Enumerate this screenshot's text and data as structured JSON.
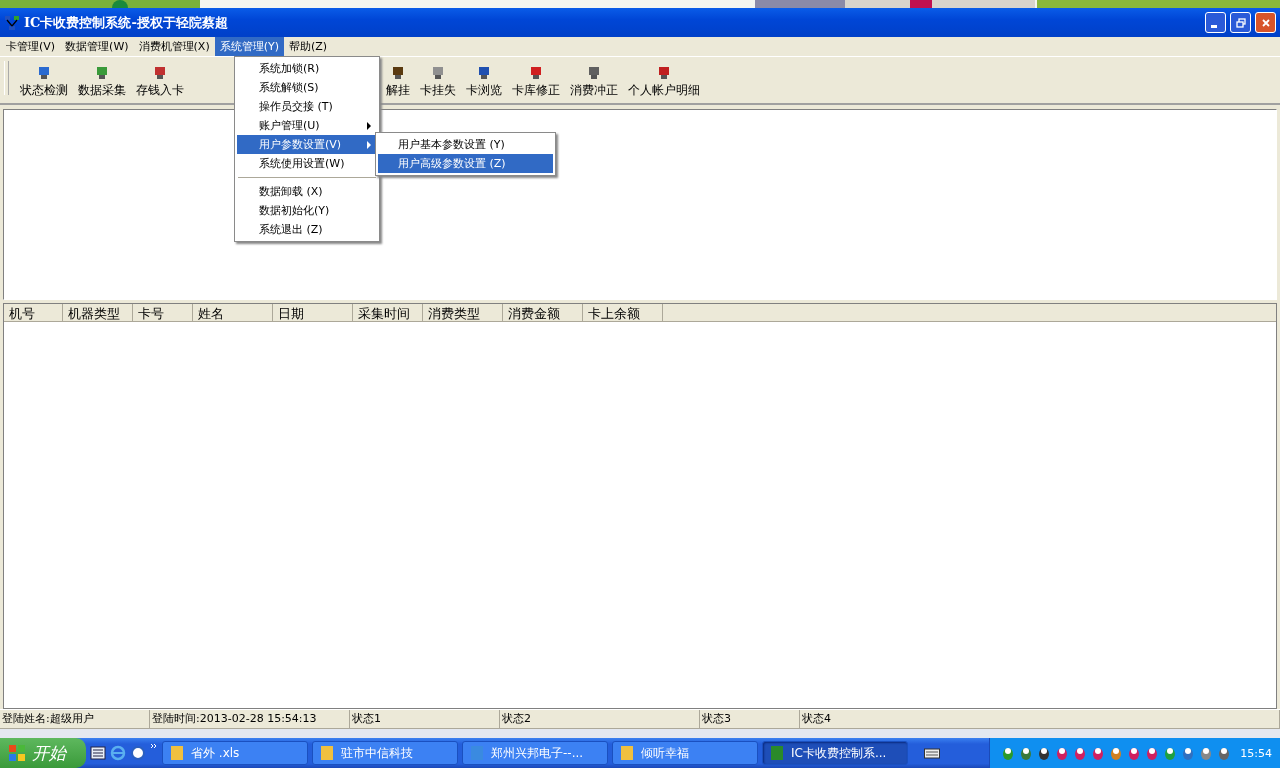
{
  "window": {
    "title": "IC卡收费控制系统-授权于轻院蔡超"
  },
  "menu": [
    {
      "label": "卡管理(V)",
      "selected": false
    },
    {
      "label": "数据管理(W)",
      "selected": false
    },
    {
      "label": "消费机管理(X)",
      "selected": false
    },
    {
      "label": "系统管理(Y)",
      "selected": true
    },
    {
      "label": "帮助(Z)",
      "selected": false
    }
  ],
  "dropdown": [
    {
      "kind": "item",
      "label": "系统加锁(R)",
      "selected": false
    },
    {
      "kind": "item",
      "label": "系统解锁(S)",
      "selected": false
    },
    {
      "kind": "item",
      "label": "操作员交接  (T)",
      "selected": false
    },
    {
      "kind": "submenu",
      "label": "账户管理(U)",
      "selected": false
    },
    {
      "kind": "submenu",
      "label": "用户参数设置(V)",
      "selected": true
    },
    {
      "kind": "item",
      "label": "系统使用设置(W)",
      "selected": false
    },
    {
      "kind": "separator"
    },
    {
      "kind": "item",
      "label": "数据卸载  (X)",
      "selected": false
    },
    {
      "kind": "item",
      "label": "数据初始化(Y)",
      "selected": false
    },
    {
      "kind": "item",
      "label": "系统退出  (Z)",
      "selected": false
    }
  ],
  "submenu": [
    {
      "label": "用户基本参数设置  (Y)",
      "selected": false
    },
    {
      "label": "用户高级参数设置  (Z)",
      "selected": true
    }
  ],
  "toolbar": [
    "状态检测",
    "数据采集",
    "存钱入卡",
    "解挂",
    "卡挂失",
    "卡浏览",
    "卡库修正",
    "消费冲正",
    "个人帐户明细"
  ],
  "table": {
    "columns": [
      "机号",
      "机器类型",
      "卡号",
      "姓名",
      "日期",
      "采集时间",
      "消费类型",
      "消费金额",
      "卡上余额"
    ]
  },
  "status_bar": [
    "登陆姓名:超级用户",
    "登陆时间:2013-02-28 15:54:13",
    "状态1",
    "状态2",
    "状态3",
    "状态4"
  ],
  "taskbar": {
    "start": "开始",
    "tasks": [
      {
        "label": "省外 .xls",
        "selected": false
      },
      {
        "label": "驻市中信科技",
        "selected": false
      },
      {
        "label": "郑州兴邦电子--...",
        "selected": false
      },
      {
        "label": "倾听幸福",
        "selected": false
      },
      {
        "label": "IC卡收费控制系...",
        "selected": true
      }
    ],
    "clock": "15:54"
  }
}
